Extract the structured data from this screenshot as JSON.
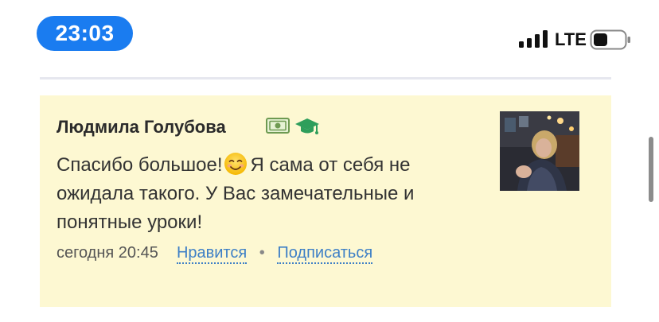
{
  "status_bar": {
    "time": "23:03",
    "network": "LTE",
    "signal_icon": "signal-bars-icon",
    "battery_icon": "battery-icon"
  },
  "comment": {
    "author": "Людмила Голубова",
    "badges": [
      "money-icon",
      "graduation-cap-icon"
    ],
    "text_before_emoji": "Спасибо большое!",
    "emoji": "smile-icon",
    "text_after_emoji": "Я сама от себя не ожидала такого. У Вас замечательные и понятные уроки!",
    "timestamp": "сегодня 20:45",
    "like_label": "Нравится",
    "separator": "•",
    "subscribe_label": "Подписаться"
  },
  "colors": {
    "time_pill": "#1a7cf0",
    "card_background": "#fdf8d2",
    "link": "#3d7fc6",
    "graduation_icon": "#2e9e5b"
  }
}
